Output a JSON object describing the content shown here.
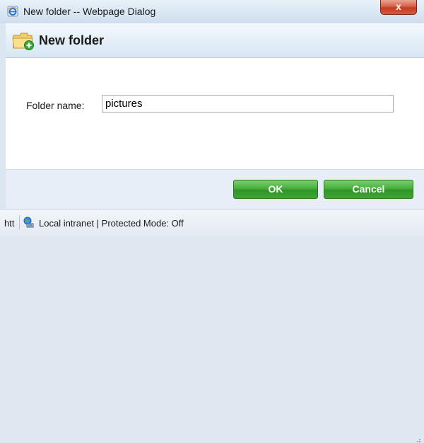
{
  "window": {
    "title": "New folder -- Webpage Dialog",
    "close_label": "x"
  },
  "dialog": {
    "header_title": "New folder",
    "folder_label": "Folder name:",
    "folder_value": "pictures",
    "ok_label": "OK",
    "cancel_label": "Cancel"
  },
  "statusbar": {
    "url_fragment": "htt",
    "zone_text": "Local intranet | Protected Mode: Off"
  },
  "icons": {
    "titlebar": "ie-page-icon",
    "header": "folder-add-icon",
    "zone": "intranet-globe-icon"
  },
  "colors": {
    "accent_green": "#3fa335",
    "close_red": "#c43b22"
  }
}
